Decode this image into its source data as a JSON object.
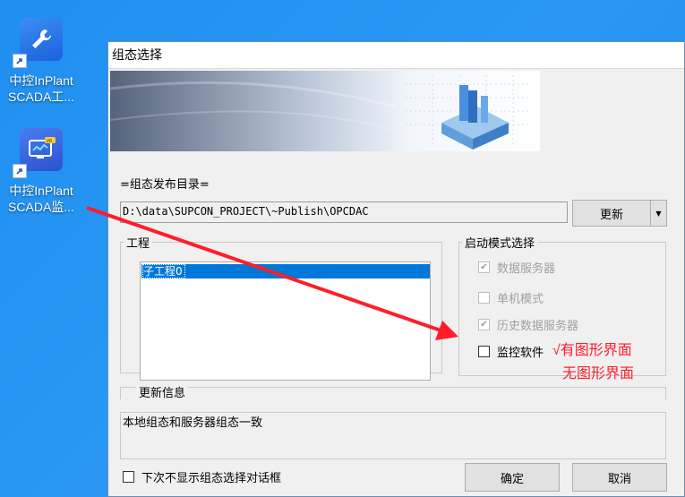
{
  "desktop": {
    "icons": [
      {
        "caption_line1": "中控InPlant",
        "caption_line2": "SCADA工...",
        "icon": "wrench-icon"
      },
      {
        "caption_line1": "中控InPlant",
        "caption_line2": "SCADA监...",
        "icon": "monitor-chart-icon",
        "badge": "V6"
      }
    ]
  },
  "dialog": {
    "title": "组态选择",
    "publish_dir_label": "=组态发布目录=",
    "publish_dir_value": "D:\\data\\SUPCON_PROJECT\\~Publish\\OPCDAC",
    "update_button": "更新",
    "project_group_title": "工程",
    "projects": [
      "子工程0"
    ],
    "mode_group_title": "启动模式选择",
    "modes": [
      {
        "label": "数据服务器",
        "checked": true,
        "enabled": false
      },
      {
        "label": "单机模式",
        "checked": false,
        "enabled": false
      },
      {
        "label": "历史数据服务器",
        "checked": true,
        "enabled": false
      },
      {
        "label": "监控软件",
        "checked": false,
        "enabled": true
      }
    ],
    "update_info_title": "更新信息",
    "update_info_text": "本地组态和服务器组态一致",
    "no_show_checkbox": "下次不显示组态选择对话框",
    "ok_button": "确定",
    "cancel_button": "取消"
  },
  "annotations": {
    "with_gui": "√有图形界面",
    "without_gui": "无图形界面",
    "color": "#ff1d2a"
  }
}
